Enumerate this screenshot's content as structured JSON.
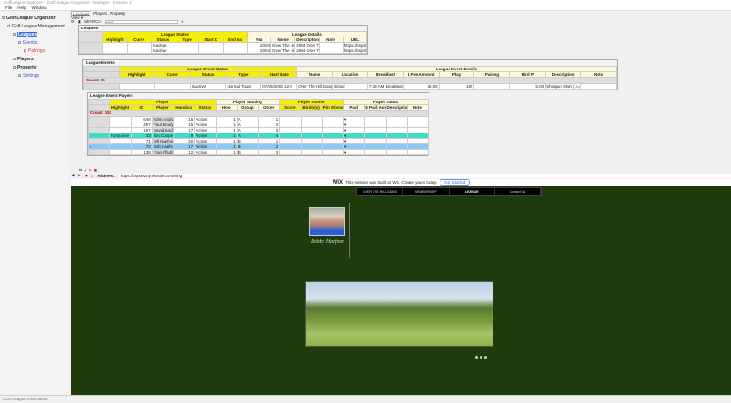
{
  "window": {
    "title": "GolfLeagueOrganizer - [Golf League Organizer - Manager - Session 1]"
  },
  "menu": [
    "File",
    "Help",
    "Window"
  ],
  "sidebar": {
    "root": "Golf League Organizer",
    "items": [
      {
        "label": "Golf League Management",
        "level": 1
      },
      {
        "label": "Leagues",
        "level": 2,
        "selected": true
      },
      {
        "label": "Events",
        "level": 3
      },
      {
        "label": "Pairings",
        "level": 4
      },
      {
        "label": "Players",
        "level": 2
      },
      {
        "label": "Property",
        "level": 2
      },
      {
        "label": "Settings",
        "level": 3
      }
    ]
  },
  "tabs": [
    "Leagues",
    "Players",
    "Property"
  ],
  "view_label": "View ▾",
  "toolbar": {
    "search_label": "SEARCH:",
    "search_placeholder": "search"
  },
  "leagues": {
    "title": "Leagues",
    "group1": "League Status",
    "group2": "League Details",
    "cols1": [
      "Highlight",
      "Curre",
      "Status",
      "Type",
      "Start D",
      "End Da"
    ],
    "cols2": [
      "Yea",
      "Name",
      "Description",
      "Note",
      "URL"
    ],
    "rows": [
      [
        "",
        "",
        "Inactive",
        "",
        "",
        "",
        "2003",
        "Over The Hill Gang",
        "2003 Over The Hill Gang Golf",
        "",
        "https://bsp002ny.wixsite.com/othg"
      ],
      [
        "",
        "",
        "Inactive",
        "",
        "",
        "",
        "2004",
        "Over The Hill Gang",
        "2004 Over The Hill Gang Golf",
        "",
        "https://bsp002ny.wixsite.com/othg"
      ]
    ]
  },
  "events": {
    "title": "League Events",
    "group1": "League Event Status",
    "group2": "League Event Details",
    "count": "Count: 26",
    "cols1": [
      "Highlight",
      "Curre",
      "Status",
      "Type",
      "Start Date"
    ],
    "cols2": [
      "Name",
      "Location",
      "Breakfast",
      "$ Fee Amount",
      "Play",
      "Pairing",
      "Bird P",
      "Description",
      "Note"
    ],
    "rows": [
      [
        "",
        "",
        "Inactive",
        "Normal Tourn",
        "07/08/2004 12:0",
        "Over The Hill Gang at Bristol Harbour",
        "Bristol",
        "7:30 AM Breakfast - Parkplace",
        "36.00",
        "157",
        "",
        "5.00",
        "Shotgun Start ( A=8:30 AM / B=9:00 AM )",
        ""
      ]
    ]
  },
  "players": {
    "title": "League Event Players",
    "group1": "Player",
    "group2": "Player Starting",
    "group3": "Player Scores",
    "group4": "Player Status",
    "count": "Count: 151",
    "cols": [
      "Highlight",
      "ID",
      "Player",
      "Handica",
      "Status",
      "Hole",
      "Group",
      "Order",
      "Score",
      "Birdie(s)",
      "Pin Winner(s)",
      "Paid",
      "$ Paid Amount",
      "Description",
      "Note"
    ],
    "rows": [
      [
        "",
        "648",
        "John Andrews",
        "16",
        "Active",
        "1",
        "A",
        "1",
        "",
        "",
        "",
        "▾",
        "",
        "",
        ""
      ],
      [
        "",
        "257",
        "Paul Brodyk",
        "15",
        "Active",
        "1",
        "A",
        "2",
        "",
        "",
        "",
        "▾",
        "",
        "",
        ""
      ],
      [
        "",
        "157",
        "David Sackett",
        "17",
        "Active",
        "1",
        "A",
        "3",
        "",
        "",
        "",
        "▾",
        "",
        "",
        ""
      ],
      [
        "Turquoise",
        "33",
        "Jim Cooper",
        "8",
        "Active",
        "1",
        "A",
        "4",
        "",
        "",
        "",
        "▾",
        "",
        "",
        ""
      ],
      [
        "",
        "71",
        "Bill Haefner",
        "20",
        "Active",
        "1",
        "B",
        "1",
        "",
        "",
        "",
        "▾",
        "",
        "",
        ""
      ],
      [
        "",
        "72",
        "Bob Haefner",
        "17",
        "Active",
        "1",
        "B",
        "2",
        "",
        "",
        "",
        "▾",
        "",
        "",
        ""
      ],
      [
        "",
        "138",
        "Fran Pfluttner",
        "12",
        "Active",
        "1",
        "B",
        "3",
        "",
        "",
        "",
        "▾",
        "",
        "",
        ""
      ]
    ],
    "row_highlights": {
      "3": "#40dcc8",
      "5": "#8cc8f4"
    },
    "selected_row": 5
  },
  "browser": {
    "address_label": "Address:",
    "address": "https://bsp002ny.wixsite.com/othg"
  },
  "site": {
    "wix_logo": "WIX",
    "wix_text": "This website was built on Wix. Create yours today.",
    "wix_button": "Get Started",
    "nav": [
      "OVER THE HILL GANG",
      "MEMBERSHIP",
      "LEAGUE",
      "Contact Us"
    ],
    "signature": "Bobby Haefner",
    "bg_color": "#1f3a0d"
  },
  "status_bar": "GLO League Information"
}
